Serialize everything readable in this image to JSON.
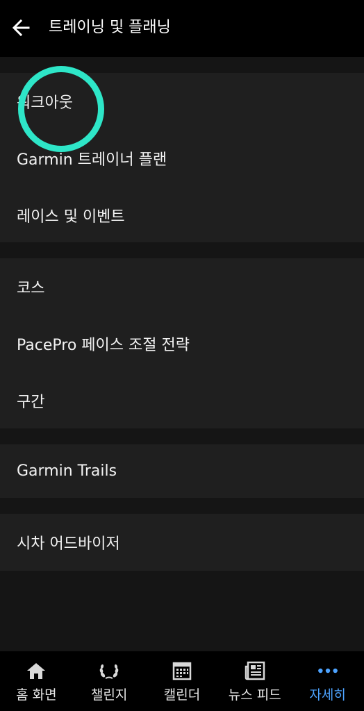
{
  "header": {
    "title": "트레이닝 및 플래닝",
    "back_icon": "arrow-left-icon"
  },
  "menu_groups": [
    {
      "items": [
        {
          "label": "워크아웃",
          "highlighted": true
        },
        {
          "label": "Garmin 트레이너 플랜"
        },
        {
          "label": "레이스 및 이벤트"
        }
      ]
    },
    {
      "items": [
        {
          "label": "코스"
        },
        {
          "label": "PacePro 페이스 조절 전략"
        },
        {
          "label": "구간"
        }
      ]
    },
    {
      "items": [
        {
          "label": "Garmin Trails"
        }
      ]
    },
    {
      "items": [
        {
          "label": "시차 어드바이저"
        }
      ]
    }
  ],
  "highlight_color": "#2ee6c8",
  "bottom_nav": [
    {
      "label": "홈 화면",
      "icon": "home-icon",
      "active": false
    },
    {
      "label": "챌린지",
      "icon": "laurel-icon",
      "active": false
    },
    {
      "label": "캘린더",
      "icon": "calendar-icon",
      "active": false
    },
    {
      "label": "뉴스 피드",
      "icon": "newspaper-icon",
      "active": false
    },
    {
      "label": "자세히",
      "icon": "more-dots-icon",
      "active": true
    }
  ],
  "colors": {
    "background": "#151515",
    "header_bg": "#000000",
    "group_bg": "#1f1f1f",
    "active_nav": "#4da3ff"
  }
}
